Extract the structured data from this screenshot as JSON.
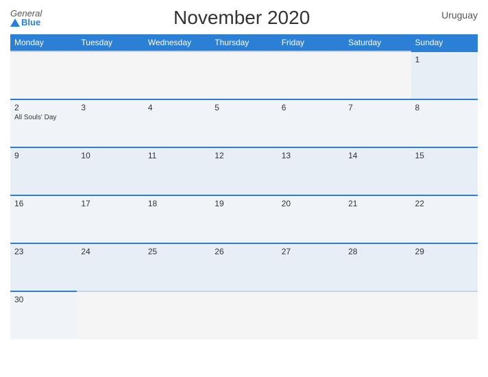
{
  "logo": {
    "general": "General",
    "blue": "Blue"
  },
  "title": "November 2020",
  "country": "Uruguay",
  "weekdays": [
    "Monday",
    "Tuesday",
    "Wednesday",
    "Thursday",
    "Friday",
    "Saturday",
    "Sunday"
  ],
  "weeks": [
    [
      {
        "day": "",
        "events": [],
        "empty": true
      },
      {
        "day": "",
        "events": [],
        "empty": true
      },
      {
        "day": "",
        "events": [],
        "empty": true
      },
      {
        "day": "",
        "events": [],
        "empty": true
      },
      {
        "day": "",
        "events": [],
        "empty": true
      },
      {
        "day": "",
        "events": [],
        "empty": true
      },
      {
        "day": "1",
        "events": []
      }
    ],
    [
      {
        "day": "2",
        "events": [
          "All Souls' Day"
        ]
      },
      {
        "day": "3",
        "events": []
      },
      {
        "day": "4",
        "events": []
      },
      {
        "day": "5",
        "events": []
      },
      {
        "day": "6",
        "events": []
      },
      {
        "day": "7",
        "events": []
      },
      {
        "day": "8",
        "events": []
      }
    ],
    [
      {
        "day": "9",
        "events": []
      },
      {
        "day": "10",
        "events": []
      },
      {
        "day": "11",
        "events": []
      },
      {
        "day": "12",
        "events": []
      },
      {
        "day": "13",
        "events": []
      },
      {
        "day": "14",
        "events": []
      },
      {
        "day": "15",
        "events": []
      }
    ],
    [
      {
        "day": "16",
        "events": []
      },
      {
        "day": "17",
        "events": []
      },
      {
        "day": "18",
        "events": []
      },
      {
        "day": "19",
        "events": []
      },
      {
        "day": "20",
        "events": []
      },
      {
        "day": "21",
        "events": []
      },
      {
        "day": "22",
        "events": []
      }
    ],
    [
      {
        "day": "23",
        "events": []
      },
      {
        "day": "24",
        "events": []
      },
      {
        "day": "25",
        "events": []
      },
      {
        "day": "26",
        "events": []
      },
      {
        "day": "27",
        "events": []
      },
      {
        "day": "28",
        "events": []
      },
      {
        "day": "29",
        "events": []
      }
    ],
    [
      {
        "day": "30",
        "events": []
      },
      {
        "day": "",
        "events": [],
        "empty": true
      },
      {
        "day": "",
        "events": [],
        "empty": true
      },
      {
        "day": "",
        "events": [],
        "empty": true
      },
      {
        "day": "",
        "events": [],
        "empty": true
      },
      {
        "day": "",
        "events": [],
        "empty": true
      },
      {
        "day": "",
        "events": [],
        "empty": true
      }
    ]
  ]
}
